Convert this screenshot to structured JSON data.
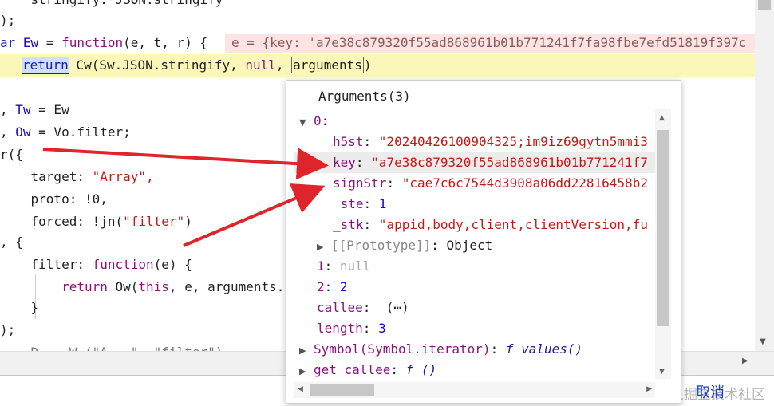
{
  "code": {
    "line1": "    stringify: JSON.stringify",
    "line2": ");",
    "line3_a": "ar ",
    "line3_b": "Ew",
    "line3_c": " = ",
    "line3_d": "function",
    "line3_e": "(e, t, r) {",
    "inline_value": "e = {key: 'a7e38c879320f55ad868961b01b771241f7fa98fbe7efd51819f397c",
    "line4_ret": "return",
    "line4_a": " Cw(Sw.JSON.stringify, ",
    "line4_null": "null",
    "line4_b": ", ",
    "line4_args": "arguments",
    "line4_c": ")",
    "line5_a": ", ",
    "line5_b": "Tw",
    "line5_c": " = Ew",
    "line6_a": ", ",
    "line6_b": "Ow",
    "line6_c": " = Vo.filter;",
    "line7": "r({",
    "line8_a": "    target: ",
    "line8_b": "\"Array\",",
    "line9": "    proto: !0,",
    "line10_a": "    forced: !jn(",
    "line10_b": "\"filter\"",
    "line10_c": ")",
    "line11": ", {",
    "line12_a": "    filter: ",
    "line12_b": "function",
    "line12_c": "(e) {",
    "line13_a": "        return",
    "line13_b": " Ow(",
    "line13_c": "this",
    "line13_d": ", e, arguments.l",
    "line14": "    }",
    "line15": ");",
    "line16": "    D... W.(\"A...\", \"filter\")"
  },
  "popup": {
    "title": "Arguments(3)",
    "items": {
      "r0_key": "0",
      "h5st_key": "h5st",
      "h5st_val": "\"20240426100904325;im9iz69gytn5mmi3",
      "key_key": "key",
      "key_val": "\"a7e38c879320f55ad868961b01b771241f7",
      "signstr_key": "signStr",
      "signstr_val": "\"cae7c6c7544d3908a06dd22816458b2",
      "ste_key": "_ste",
      "ste_val": "1",
      "stk_key": "_stk",
      "stk_val": "\"appid,body,client,clientVersion,fu",
      "proto_label": "[[Prototype]]",
      "proto_val": "Object",
      "r1_key": "1",
      "r1_val": "null",
      "r2_key": "2",
      "r2_val": "2",
      "callee_key": "callee",
      "callee_val": "(⋯)",
      "length_key": "length",
      "length_val": "3",
      "symbol_key": "Symbol(Symbol.iterator)",
      "symbol_f": "f",
      "symbol_val": "values()",
      "getcallee_key": "get callee",
      "getcallee_f": "f",
      "getcallee_val": "()"
    }
  },
  "footer": {
    "cancel_label": "取消",
    "watermark": "@稀土掘金技术社区"
  },
  "icons": {
    "expand": "triangle-down",
    "collapse": "triangle-right"
  },
  "colors": {
    "annotation_arrow": "#e0242b",
    "highlight_line": "#fbf7b9"
  }
}
